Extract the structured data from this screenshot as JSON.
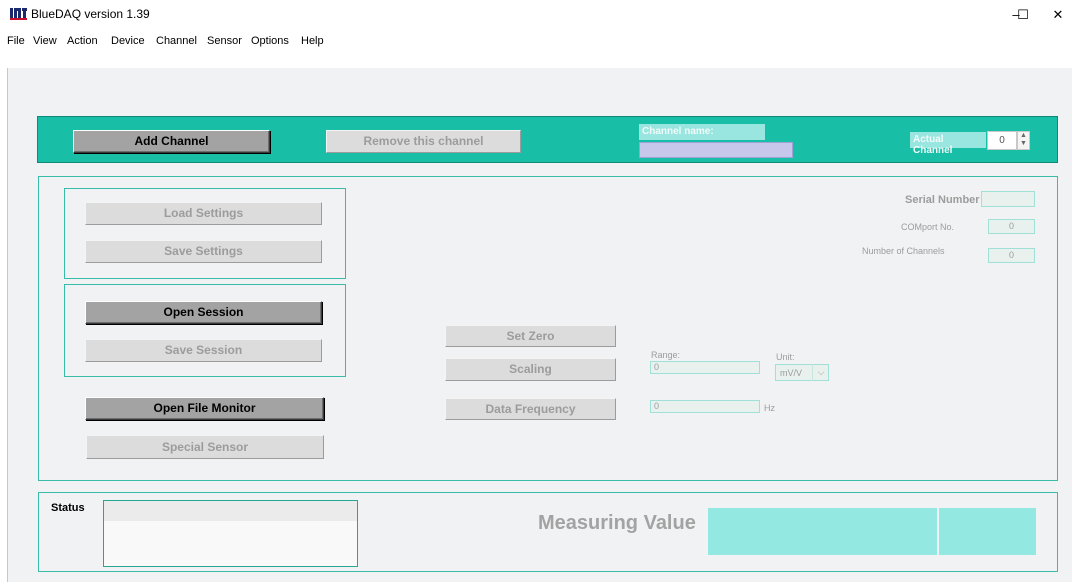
{
  "window": {
    "title": "BlueDAQ version 1.39",
    "minimize": "–",
    "maximize": "☐",
    "close": "✕"
  },
  "menu": [
    "File",
    "View",
    "Action",
    "Device",
    "Channel",
    "Sensor",
    "Options",
    "Help"
  ],
  "channel_bar": {
    "add_channel": "Add Channel",
    "remove_channel": "Remove this channel",
    "channel_name_label": "Channel name:",
    "channel_name_value": "",
    "actual_channel_label": "Actual Channel",
    "actual_channel_value": "0"
  },
  "settings": {
    "load_settings": "Load Settings",
    "save_settings": "Save Settings"
  },
  "session": {
    "open_session": "Open Session",
    "save_session": "Save Session"
  },
  "file_monitor": "Open File Monitor",
  "special_sensor": "Special Sensor",
  "controls": {
    "set_zero": "Set Zero",
    "scaling": "Scaling",
    "data_frequency": "Data Frequency",
    "range_label": "Range:",
    "range_value": "0",
    "unit_label": "Unit:",
    "unit_value": "mV/V",
    "frequency_value": "0",
    "frequency_unit": "Hz"
  },
  "device_info": {
    "serial_label": "Serial Number",
    "serial_value": "",
    "comport_label": "COMport No.",
    "comport_value": "0",
    "channels_label": "Number of Channels",
    "channels_value": "0"
  },
  "status": {
    "label": "Status",
    "text": "",
    "measuring_label": "Measuring Value",
    "measuring_value": "",
    "measuring_unit": ""
  },
  "colors": {
    "accent": "#19bea6",
    "panel_border": "#38bba8",
    "value_fill": "#93e8e1",
    "channel_name_field": "#c6c7ea"
  }
}
